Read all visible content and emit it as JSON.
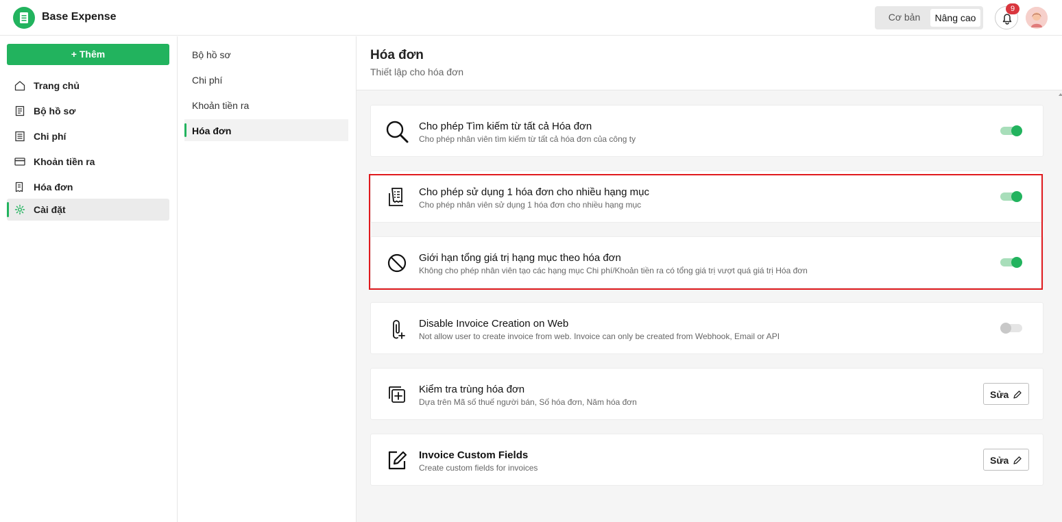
{
  "app": {
    "title": "Base Expense",
    "brand_color": "#22b35e"
  },
  "header": {
    "mode_basic": "Cơ bản",
    "mode_advanced": "Nâng cao",
    "notification_count": "9"
  },
  "sidebar": {
    "add_label": "+ Thêm",
    "items": [
      {
        "label": "Trang chủ",
        "icon": "home-icon"
      },
      {
        "label": "Bộ hồ sơ",
        "icon": "document-icon"
      },
      {
        "label": "Chi phí",
        "icon": "list-icon"
      },
      {
        "label": "Khoản tiền ra",
        "icon": "card-icon"
      },
      {
        "label": "Hóa đơn",
        "icon": "invoice-icon"
      },
      {
        "label": "Cài đặt",
        "icon": "gear-icon",
        "active": true
      }
    ]
  },
  "subnav": {
    "items": [
      {
        "label": "Bộ hồ sơ"
      },
      {
        "label": "Chi phí"
      },
      {
        "label": "Khoản tiền ra"
      },
      {
        "label": "Hóa đơn",
        "active": true
      }
    ]
  },
  "main": {
    "title": "Hóa đơn",
    "subtitle": "Thiết lập cho hóa đơn",
    "settings": [
      {
        "icon": "search-icon",
        "title": "Cho phép Tìm kiếm từ tất cả Hóa đơn",
        "desc": "Cho phép nhân viên tìm kiếm từ tất cả hóa đơn của công ty",
        "control": "toggle",
        "enabled": true
      },
      {
        "icon": "receipt-stack-icon",
        "title": "Cho phép sử dụng 1 hóa đơn cho nhiều hạng mục",
        "desc": "Cho phép nhân viên sử dụng 1 hóa đơn cho nhiều hạng mục",
        "control": "toggle",
        "enabled": true
      },
      {
        "icon": "prohibited-icon",
        "title": "Giới hạn tổng giá trị hạng mục theo hóa đơn",
        "desc": "Không cho phép nhân viên tạo các hạng mục Chi phí/Khoản tiền ra có tổng giá trị vượt quá giá trị Hóa đơn",
        "control": "toggle",
        "enabled": true
      },
      {
        "icon": "attachment-add-icon",
        "title": "Disable Invoice Creation on Web",
        "desc": "Not allow user to create invoice from web. Invoice can only be created from Webhook, Email or API",
        "control": "toggle",
        "enabled": false
      },
      {
        "icon": "duplicate-check-icon",
        "title": "Kiểm tra trùng hóa đơn",
        "desc": "Dựa trên Mã số thuế người bán, Số hóa đơn, Năm hóa đơn",
        "control": "button",
        "button_label": "Sửa"
      },
      {
        "icon": "edit-form-icon",
        "title": "Invoice Custom Fields",
        "desc": "Create custom fields for invoices",
        "control": "button",
        "button_label": "Sửa"
      }
    ]
  }
}
